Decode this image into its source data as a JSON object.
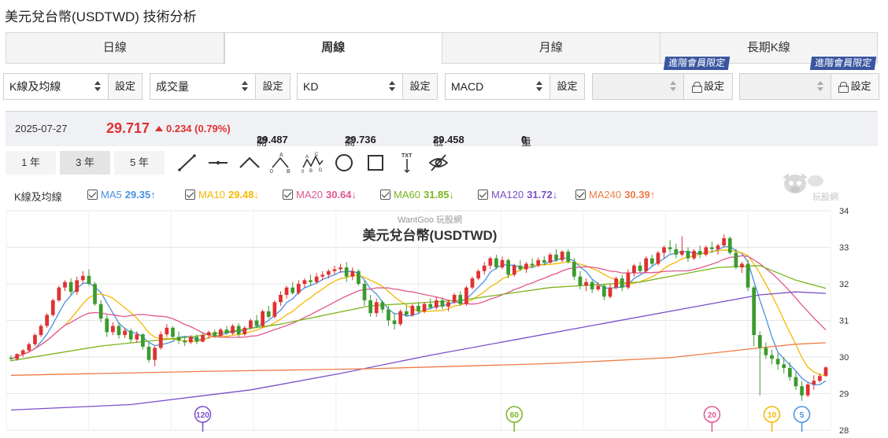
{
  "page": {
    "title": "美元兌台幣(USDTWD) 技術分析"
  },
  "period_tabs": [
    {
      "label": "日線",
      "active": false
    },
    {
      "label": "周線",
      "active": true
    },
    {
      "label": "月線",
      "active": false
    },
    {
      "label": "長期K線",
      "active": false
    }
  ],
  "indicators": [
    {
      "select": "K線及均線",
      "button": "設定",
      "locked": false
    },
    {
      "select": "成交量",
      "button": "設定",
      "locked": false
    },
    {
      "select": "KD",
      "button": "設定",
      "locked": false
    },
    {
      "select": "MACD",
      "button": "設定",
      "locked": false
    },
    {
      "select": "",
      "button": "設定",
      "locked": true,
      "badge": "進階會員限定"
    },
    {
      "select": "",
      "button": "設定",
      "locked": true,
      "badge": "進階會員限定"
    }
  ],
  "quote": {
    "date": "2025-07-27",
    "price": "29.717",
    "change": "0.234 (0.79%)",
    "open_label": "開",
    "open": "29.487",
    "high_label": "高",
    "high": "29.736",
    "low_label": "低",
    "low": "29.458",
    "volume_label": "量",
    "volume": "0"
  },
  "ranges": [
    {
      "label": "1 年",
      "active": false
    },
    {
      "label": "3 年",
      "active": true
    },
    {
      "label": "5 年",
      "active": false
    }
  ],
  "tools": [
    "trend-line-icon",
    "horizontal-line-icon",
    "polyline-icon",
    "abcd-pattern-icon",
    "wave-pattern-icon",
    "circle-icon",
    "rectangle-icon",
    "text-tool-icon",
    "hide-icon"
  ],
  "tool_texts": {
    "pattern_a": "A",
    "pattern_b": "B",
    "pattern_o": "0",
    "wave_a": "A",
    "wave_b": "B",
    "wave_c": "C",
    "wave_d": "D",
    "wave_o": "0",
    "text_tool": "TXT"
  },
  "ma_legend": {
    "title": "K線及均線",
    "items": [
      {
        "label": "MA5",
        "value": "29.35↑",
        "color": "#4a90e2"
      },
      {
        "label": "MA10",
        "value": "29.48↓",
        "color": "#f5b800"
      },
      {
        "label": "MA20",
        "value": "30.64↓",
        "color": "#e0578f"
      },
      {
        "label": "MA60",
        "value": "31.85↓",
        "color": "#7ab51d"
      },
      {
        "label": "MA120",
        "value": "31.72↓",
        "color": "#7b4fc9"
      },
      {
        "label": "MA240",
        "value": "30.39↑",
        "color": "#ef7b45"
      }
    ]
  },
  "logo": {
    "text": "玩股網"
  },
  "colors": {
    "up": "#e03131",
    "down": "#3c9a2e",
    "grid": "#e6e6e6"
  },
  "chart_data": {
    "type": "candlestick",
    "watermark": "WantGoo 玩股網",
    "title": "美元兌台幣(USDTWD)",
    "ylim": [
      28,
      34
    ],
    "yticks": [
      34,
      33,
      32,
      31,
      30,
      29,
      28
    ],
    "grid": true,
    "candles": [
      [
        29.98,
        30.05,
        29.88,
        29.95
      ],
      [
        29.95,
        30.1,
        29.9,
        30.08
      ],
      [
        30.08,
        30.22,
        30.0,
        30.18
      ],
      [
        30.18,
        30.4,
        30.12,
        30.35
      ],
      [
        30.35,
        30.65,
        30.3,
        30.6
      ],
      [
        30.6,
        30.9,
        30.55,
        30.85
      ],
      [
        30.85,
        31.2,
        30.8,
        31.15
      ],
      [
        31.15,
        31.6,
        31.1,
        31.55
      ],
      [
        31.55,
        31.95,
        31.5,
        31.9
      ],
      [
        31.9,
        32.1,
        31.8,
        32.05
      ],
      [
        32.05,
        32.15,
        31.7,
        31.78
      ],
      [
        31.78,
        32.2,
        31.7,
        32.1
      ],
      [
        32.1,
        32.35,
        32.0,
        32.22
      ],
      [
        32.22,
        32.4,
        31.95,
        32.0
      ],
      [
        32.0,
        32.05,
        31.4,
        31.45
      ],
      [
        31.45,
        31.55,
        30.95,
        31.05
      ],
      [
        31.05,
        31.15,
        30.55,
        30.68
      ],
      [
        30.68,
        30.95,
        30.6,
        30.85
      ],
      [
        30.85,
        30.95,
        30.5,
        30.6
      ],
      [
        30.6,
        30.8,
        30.52,
        30.72
      ],
      [
        30.72,
        30.78,
        30.4,
        30.48
      ],
      [
        30.48,
        30.7,
        30.4,
        30.62
      ],
      [
        30.62,
        30.65,
        30.2,
        30.28
      ],
      [
        30.28,
        30.4,
        29.85,
        29.92
      ],
      [
        29.92,
        30.3,
        29.75,
        30.25
      ],
      [
        30.25,
        30.7,
        30.2,
        30.62
      ],
      [
        30.62,
        30.9,
        30.55,
        30.8
      ],
      [
        30.8,
        30.85,
        30.5,
        30.55
      ],
      [
        30.55,
        30.7,
        30.35,
        30.45
      ],
      [
        30.45,
        30.55,
        30.3,
        30.4
      ],
      [
        30.4,
        30.6,
        30.35,
        30.55
      ],
      [
        30.55,
        30.62,
        30.35,
        30.42
      ],
      [
        30.42,
        30.65,
        30.4,
        30.6
      ],
      [
        30.6,
        30.72,
        30.5,
        30.68
      ],
      [
        30.68,
        30.75,
        30.52,
        30.58
      ],
      [
        30.58,
        30.8,
        30.55,
        30.75
      ],
      [
        30.75,
        30.85,
        30.6,
        30.65
      ],
      [
        30.65,
        30.9,
        30.6,
        30.85
      ],
      [
        30.85,
        30.92,
        30.55,
        30.62
      ],
      [
        30.62,
        30.85,
        30.58,
        30.8
      ],
      [
        30.8,
        31.05,
        30.75,
        31.0
      ],
      [
        31.0,
        31.15,
        30.8,
        30.85
      ],
      [
        30.85,
        31.3,
        30.8,
        31.25
      ],
      [
        31.25,
        31.4,
        31.05,
        31.1
      ],
      [
        31.1,
        31.55,
        31.05,
        31.5
      ],
      [
        31.5,
        31.8,
        31.4,
        31.7
      ],
      [
        31.7,
        31.95,
        31.6,
        31.9
      ],
      [
        31.9,
        32.05,
        31.7,
        31.75
      ],
      [
        31.75,
        32.1,
        31.7,
        32.0
      ],
      [
        32.0,
        32.15,
        31.9,
        32.1
      ],
      [
        32.1,
        32.25,
        31.95,
        32.05
      ],
      [
        32.05,
        32.3,
        32.0,
        32.2
      ],
      [
        32.2,
        32.35,
        32.1,
        32.25
      ],
      [
        32.25,
        32.4,
        32.15,
        32.35
      ],
      [
        32.35,
        32.5,
        32.25,
        32.4
      ],
      [
        32.4,
        32.55,
        32.3,
        32.45
      ],
      [
        32.45,
        32.6,
        32.05,
        32.2
      ],
      [
        32.2,
        32.45,
        32.1,
        32.35
      ],
      [
        32.35,
        32.4,
        31.95,
        32.0
      ],
      [
        32.0,
        32.1,
        31.4,
        31.55
      ],
      [
        31.55,
        31.7,
        31.1,
        31.2
      ],
      [
        31.2,
        31.6,
        31.1,
        31.5
      ],
      [
        31.5,
        31.55,
        31.2,
        31.3
      ],
      [
        31.3,
        31.4,
        30.85,
        31.0
      ],
      [
        31.0,
        31.2,
        30.75,
        30.9
      ],
      [
        30.9,
        31.3,
        30.85,
        31.25
      ],
      [
        31.25,
        31.4,
        31.1,
        31.15
      ],
      [
        31.15,
        31.45,
        31.1,
        31.4
      ],
      [
        31.4,
        31.5,
        31.2,
        31.25
      ],
      [
        31.25,
        31.5,
        31.2,
        31.45
      ],
      [
        31.45,
        31.6,
        31.3,
        31.35
      ],
      [
        31.35,
        31.65,
        31.3,
        31.55
      ],
      [
        31.55,
        31.62,
        31.3,
        31.38
      ],
      [
        31.38,
        31.55,
        31.25,
        31.5
      ],
      [
        31.5,
        31.75,
        31.45,
        31.7
      ],
      [
        31.7,
        31.8,
        31.4,
        31.45
      ],
      [
        31.45,
        31.95,
        31.4,
        31.9
      ],
      [
        31.9,
        32.2,
        31.85,
        32.15
      ],
      [
        32.15,
        32.4,
        32.1,
        32.35
      ],
      [
        32.35,
        32.6,
        32.25,
        32.5
      ],
      [
        32.5,
        32.75,
        32.4,
        32.7
      ],
      [
        32.7,
        32.8,
        32.4,
        32.45
      ],
      [
        32.45,
        32.75,
        32.4,
        32.65
      ],
      [
        32.65,
        32.7,
        32.15,
        32.25
      ],
      [
        32.25,
        32.55,
        32.2,
        32.5
      ],
      [
        32.5,
        32.65,
        32.35,
        32.4
      ],
      [
        32.4,
        32.6,
        32.3,
        32.55
      ],
      [
        32.55,
        32.7,
        32.45,
        32.5
      ],
      [
        32.5,
        32.72,
        32.45,
        32.65
      ],
      [
        32.65,
        32.75,
        32.5,
        32.58
      ],
      [
        32.58,
        32.85,
        32.55,
        32.8
      ],
      [
        32.8,
        32.95,
        32.6,
        32.65
      ],
      [
        32.65,
        32.92,
        32.6,
        32.88
      ],
      [
        32.88,
        32.95,
        32.55,
        32.6
      ],
      [
        32.6,
        32.7,
        32.1,
        32.2
      ],
      [
        32.2,
        32.35,
        31.85,
        31.95
      ],
      [
        31.95,
        32.15,
        31.8,
        32.05
      ],
      [
        32.05,
        32.1,
        31.75,
        31.85
      ],
      [
        31.85,
        32.05,
        31.8,
        31.95
      ],
      [
        31.95,
        32.0,
        31.55,
        31.65
      ],
      [
        31.65,
        32.0,
        31.6,
        31.9
      ],
      [
        31.9,
        32.2,
        31.85,
        32.15
      ],
      [
        32.15,
        32.25,
        31.8,
        31.9
      ],
      [
        31.9,
        32.4,
        31.85,
        32.3
      ],
      [
        32.3,
        32.55,
        32.2,
        32.5
      ],
      [
        32.5,
        32.6,
        32.3,
        32.35
      ],
      [
        32.35,
        32.75,
        32.3,
        32.7
      ],
      [
        32.7,
        32.8,
        32.5,
        32.55
      ],
      [
        32.55,
        32.9,
        32.5,
        32.85
      ],
      [
        32.85,
        33.05,
        32.7,
        33.0
      ],
      [
        33.0,
        33.2,
        32.85,
        32.95
      ],
      [
        32.95,
        33.1,
        32.7,
        32.8
      ],
      [
        32.8,
        33.3,
        32.75,
        32.9
      ],
      [
        32.9,
        33.0,
        32.6,
        32.7
      ],
      [
        32.7,
        32.95,
        32.65,
        32.9
      ],
      [
        32.9,
        33.05,
        32.7,
        32.8
      ],
      [
        32.8,
        33.05,
        32.75,
        33.0
      ],
      [
        33.0,
        33.15,
        32.85,
        32.95
      ],
      [
        32.95,
        33.1,
        32.8,
        33.05
      ],
      [
        33.05,
        33.35,
        33.0,
        33.25
      ],
      [
        33.25,
        33.3,
        32.8,
        32.85
      ],
      [
        32.85,
        32.95,
        32.4,
        32.45
      ],
      [
        32.45,
        32.6,
        32.3,
        32.55
      ],
      [
        32.55,
        32.65,
        31.8,
        31.9
      ],
      [
        31.9,
        31.95,
        30.3,
        30.6
      ],
      [
        30.6,
        30.7,
        28.95,
        30.25
      ],
      [
        30.25,
        30.4,
        29.95,
        30.05
      ],
      [
        30.05,
        30.2,
        29.8,
        29.95
      ],
      [
        29.95,
        30.1,
        29.65,
        29.8
      ],
      [
        29.8,
        30.0,
        29.55,
        29.7
      ],
      [
        29.7,
        29.85,
        29.35,
        29.45
      ],
      [
        29.45,
        29.6,
        29.1,
        29.2
      ],
      [
        29.2,
        29.35,
        28.8,
        28.95
      ],
      [
        28.95,
        29.3,
        28.9,
        29.25
      ],
      [
        29.25,
        29.5,
        29.1,
        29.35
      ],
      [
        29.35,
        29.55,
        29.3,
        29.48
      ],
      [
        29.487,
        29.736,
        29.458,
        29.717
      ]
    ],
    "ma_series": [
      {
        "name": "MA5",
        "color": "#4a90e2"
      },
      {
        "name": "MA10",
        "color": "#f5b800"
      },
      {
        "name": "MA20",
        "color": "#e0578f"
      },
      {
        "name": "MA60",
        "color": "#7ab51d",
        "path": [
          [
            0,
            29.9
          ],
          [
            15,
            30.3
          ],
          [
            30,
            30.55
          ],
          [
            45,
            30.9
          ],
          [
            60,
            31.4
          ],
          [
            75,
            31.55
          ],
          [
            90,
            31.9
          ],
          [
            105,
            32.05
          ],
          [
            118,
            32.45
          ],
          [
            125,
            32.5
          ],
          [
            131,
            32.1
          ],
          [
            136,
            31.88
          ]
        ]
      },
      {
        "name": "MA120",
        "color": "#7b4fc9",
        "path": [
          [
            0,
            28.55
          ],
          [
            20,
            28.7
          ],
          [
            40,
            29.1
          ],
          [
            55,
            29.55
          ],
          [
            70,
            30.05
          ],
          [
            85,
            30.5
          ],
          [
            100,
            30.95
          ],
          [
            115,
            31.4
          ],
          [
            125,
            31.7
          ],
          [
            131,
            31.78
          ],
          [
            136,
            31.74
          ]
        ]
      },
      {
        "name": "MA240",
        "color": "#ef7b45",
        "path": [
          [
            0,
            29.5
          ],
          [
            30,
            29.6
          ],
          [
            60,
            29.68
          ],
          [
            90,
            29.82
          ],
          [
            110,
            29.98
          ],
          [
            125,
            30.25
          ],
          [
            131,
            30.35
          ],
          [
            136,
            30.39
          ]
        ]
      }
    ],
    "markers": [
      {
        "label": "120",
        "index": 32,
        "color": "#7b4fc9"
      },
      {
        "label": "60",
        "index": 84,
        "color": "#7ab51d"
      },
      {
        "label": "20",
        "index": 117,
        "color": "#e0578f"
      },
      {
        "label": "10",
        "index": 127,
        "color": "#f5b800"
      },
      {
        "label": "5",
        "index": 132,
        "color": "#4a90e2"
      }
    ]
  }
}
